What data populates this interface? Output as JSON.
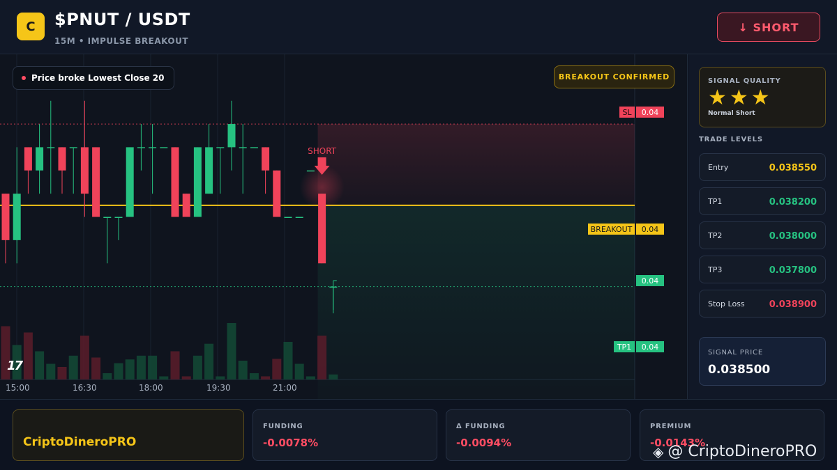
{
  "header": {
    "logo_letter": "C",
    "pair": "$PNUT / USDT",
    "subtitle": "15M • IMPULSE BREAKOUT",
    "short_button": "↓ SHORT"
  },
  "chart": {
    "notice": "Price broke Lowest Close 20",
    "confirmed_badge": "BREAKOUT CONFIRMED",
    "short_marker": "SHORT",
    "tv_logo": "17",
    "tags": {
      "sl_label": "SL",
      "sl_value": "0.04",
      "breakout_label": "BREAKOUT",
      "breakout_value": "0.04",
      "current_value": "0.04",
      "tp1_label": "TP1",
      "tp1_value": "0.04"
    },
    "time_labels": [
      "15:00",
      "16:30",
      "18:00",
      "19:30",
      "21:00"
    ],
    "colors": {
      "up": "#26c281",
      "down": "#f0435a",
      "breakout": "#f5c518",
      "sl": "#f0435a",
      "tp": "#26c281"
    }
  },
  "chart_data": {
    "type": "candlestick",
    "x": [
      "15:00",
      "16:30",
      "18:00",
      "19:30",
      "21:00"
    ],
    "candles": [
      {
        "o": 0.0386,
        "h": 0.0386,
        "l": 0.0383,
        "c": 0.0384,
        "v": 0.85
      },
      {
        "o": 0.0384,
        "h": 0.0388,
        "l": 0.0383,
        "c": 0.0386,
        "v": 0.55
      },
      {
        "o": 0.0388,
        "h": 0.0388,
        "l": 0.0386,
        "c": 0.0387,
        "v": 0.75
      },
      {
        "o": 0.0387,
        "h": 0.0389,
        "l": 0.0386,
        "c": 0.0388,
        "v": 0.45
      },
      {
        "o": 0.0388,
        "h": 0.039,
        "l": 0.0386,
        "c": 0.0388,
        "v": 0.25
      },
      {
        "o": 0.0388,
        "h": 0.0388,
        "l": 0.0386,
        "c": 0.0387,
        "v": 0.2
      },
      {
        "o": 0.0388,
        "h": 0.0388,
        "l": 0.0386,
        "c": 0.0388,
        "v": 0.38
      },
      {
        "o": 0.0388,
        "h": 0.039,
        "l": 0.0385,
        "c": 0.0386,
        "v": 0.7
      },
      {
        "o": 0.0388,
        "h": 0.0388,
        "l": 0.0385,
        "c": 0.0385,
        "v": 0.35
      },
      {
        "o": 0.0385,
        "h": 0.0385,
        "l": 0.0383,
        "c": 0.0385,
        "v": 0.1
      },
      {
        "o": 0.0385,
        "h": 0.0385,
        "l": 0.0384,
        "c": 0.0385,
        "v": 0.26
      },
      {
        "o": 0.0385,
        "h": 0.0388,
        "l": 0.0385,
        "c": 0.0388,
        "v": 0.32
      },
      {
        "o": 0.0388,
        "h": 0.0389,
        "l": 0.0387,
        "c": 0.0388,
        "v": 0.38
      },
      {
        "o": 0.0388,
        "h": 0.0389,
        "l": 0.0386,
        "c": 0.0388,
        "v": 0.38
      },
      {
        "o": 0.0388,
        "h": 0.0388,
        "l": 0.0388,
        "c": 0.0388,
        "v": 0.05
      },
      {
        "o": 0.0388,
        "h": 0.0388,
        "l": 0.0385,
        "c": 0.0385,
        "v": 0.45
      },
      {
        "o": 0.0386,
        "h": 0.0386,
        "l": 0.0385,
        "c": 0.0385,
        "v": 0.05
      },
      {
        "o": 0.0385,
        "h": 0.0388,
        "l": 0.0385,
        "c": 0.0388,
        "v": 0.38
      },
      {
        "o": 0.0386,
        "h": 0.0389,
        "l": 0.0386,
        "c": 0.0388,
        "v": 0.57
      },
      {
        "o": 0.0388,
        "h": 0.0388,
        "l": 0.0386,
        "c": 0.0388,
        "v": 0.05
      },
      {
        "o": 0.0388,
        "h": 0.039,
        "l": 0.0387,
        "c": 0.0389,
        "v": 0.9
      },
      {
        "o": 0.0388,
        "h": 0.0389,
        "l": 0.0386,
        "c": 0.0388,
        "v": 0.3
      },
      {
        "o": 0.0388,
        "h": 0.0388,
        "l": 0.0388,
        "c": 0.0388,
        "v": 0.1
      },
      {
        "o": 0.0388,
        "h": 0.0388,
        "l": 0.0386,
        "c": 0.0387,
        "v": 0.05
      },
      {
        "o": 0.0387,
        "h": 0.0387,
        "l": 0.0385,
        "c": 0.0385,
        "v": 0.33
      },
      {
        "o": 0.0385,
        "h": 0.0385,
        "l": 0.0385,
        "c": 0.0385,
        "v": 0.6
      },
      {
        "o": 0.0385,
        "h": 0.0385,
        "l": 0.0385,
        "c": 0.0385,
        "v": 0.25
      },
      {
        "o": 0.0387,
        "h": 0.0387,
        "l": 0.0387,
        "c": 0.0387,
        "v": 0.05
      },
      {
        "o": 0.0386,
        "h": 0.0386,
        "l": 0.0383,
        "c": 0.0383,
        "v": 0.7
      },
      {
        "o": 0.0382,
        "h": 0.0382,
        "l": 0.0381,
        "c": 0.0382,
        "v": 0.08
      }
    ],
    "ylim": [
      0.0378,
      0.0392
    ],
    "levels": {
      "sl": 0.0389,
      "breakout": 0.03855,
      "tp1": 0.0382
    },
    "signal_index": 28
  },
  "sidebar": {
    "quality_label": "SIGNAL QUALITY",
    "stars": "★★★",
    "quality_sub": "Normal Short",
    "levels_title": "TRADE LEVELS",
    "levels": [
      {
        "label": "Entry",
        "value": "0.038550",
        "color": "#f5c518"
      },
      {
        "label": "TP1",
        "value": "0.038200",
        "color": "#26c281"
      },
      {
        "label": "TP2",
        "value": "0.038000",
        "color": "#26c281"
      },
      {
        "label": "TP3",
        "value": "0.037800",
        "color": "#26c281"
      },
      {
        "label": "Stop Loss",
        "value": "0.038900",
        "color": "#f0435a"
      }
    ],
    "signal_price_label": "SIGNAL PRICE",
    "signal_price": "0.038500"
  },
  "bottom": {
    "brand": "CriptoDineroPRO",
    "metrics": [
      {
        "label": "FUNDING",
        "value": "-0.0078%"
      },
      {
        "label": "Δ FUNDING",
        "value": "-0.0094%"
      },
      {
        "label": "PREMIUM",
        "value": "-0.0143%"
      }
    ],
    "watermark_icon": "binance-icon",
    "watermark": "@ CriptoDineroPRO"
  }
}
